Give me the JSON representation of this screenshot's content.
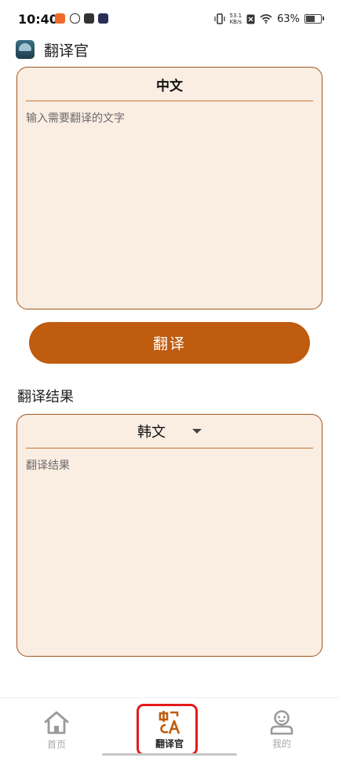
{
  "status_bar": {
    "time": "10:40",
    "network_speed_value": "53.1",
    "network_speed_unit": "KB/s",
    "battery": "63%"
  },
  "app": {
    "title": "翻译官"
  },
  "source": {
    "language": "中文",
    "placeholder": "输入需要翻译的文字"
  },
  "translate_button": {
    "label": "翻译"
  },
  "result": {
    "section_title": "翻译结果",
    "language": "韩文",
    "placeholder": "翻译结果"
  },
  "bottom_nav": {
    "items": [
      {
        "label": "首页",
        "icon": "home-icon",
        "active": false
      },
      {
        "label": "翻译官",
        "icon": "translate-icon",
        "active": true
      },
      {
        "label": "我的",
        "icon": "person-icon",
        "active": false
      }
    ]
  },
  "colors": {
    "accent": "#c05c10",
    "card_bg": "#faede2",
    "card_border": "#a5541a",
    "highlight": "#e21b1b"
  }
}
